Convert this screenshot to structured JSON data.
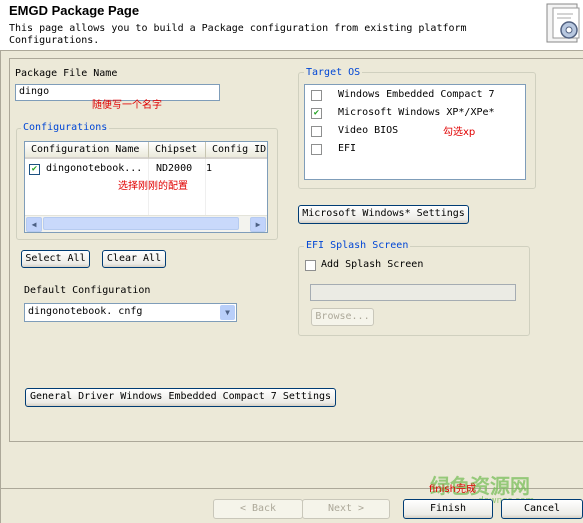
{
  "header": {
    "title": "EMGD Package Page",
    "description": "This page allows you to build a Package configuration from existing platform Configurations."
  },
  "package": {
    "label": "Package File Name",
    "value": "dingo",
    "note": "随便写一个名字"
  },
  "configurations": {
    "group_label": "Configurations",
    "columns": [
      "Configuration Name",
      "Chipset",
      "Config ID"
    ],
    "rows": [
      {
        "checked": true,
        "name": "dingonotebook...",
        "chipset": "ND2000",
        "config_id": "1"
      }
    ],
    "note": "选择刚刚的配置"
  },
  "buttons": {
    "select_all": "Select All",
    "clear_all": "Clear All",
    "windows_settings": "Microsoft Windows* Settings",
    "general_driver": "General Driver Windows Embedded Compact 7 Settings",
    "browse": "Browse...",
    "back": "< Back",
    "next": "Next >",
    "finish": "Finish",
    "cancel": "Cancel"
  },
  "default_config": {
    "label": "Default Configuration",
    "value": "dingonotebook. cnfg"
  },
  "target_os": {
    "group_label": "Target OS",
    "items": [
      {
        "label": "Windows Embedded Compact 7",
        "checked": false
      },
      {
        "label": "Microsoft Windows XP*/XPe*",
        "checked": true
      },
      {
        "label": "Video BIOS",
        "checked": false
      },
      {
        "label": "EFI",
        "checked": false
      }
    ],
    "note": "勾选xp"
  },
  "efi_splash": {
    "group_label": "EFI Splash Screen",
    "checkbox_label": "Add Splash Screen",
    "path_value": ""
  },
  "finish_note": "finish完成",
  "watermark": {
    "text": "绿色资源网",
    "sub": "downcc.com"
  },
  "colors": {
    "accent": "#0046d5",
    "note": "#e00000",
    "dialog_bg": "#ece9d8"
  },
  "icons": {
    "header": "gear-document-icon",
    "checkmark": "check-icon",
    "scroll_left": "triangle-left-icon",
    "scroll_right": "triangle-right-icon",
    "dropdown": "chevron-down-icon"
  }
}
